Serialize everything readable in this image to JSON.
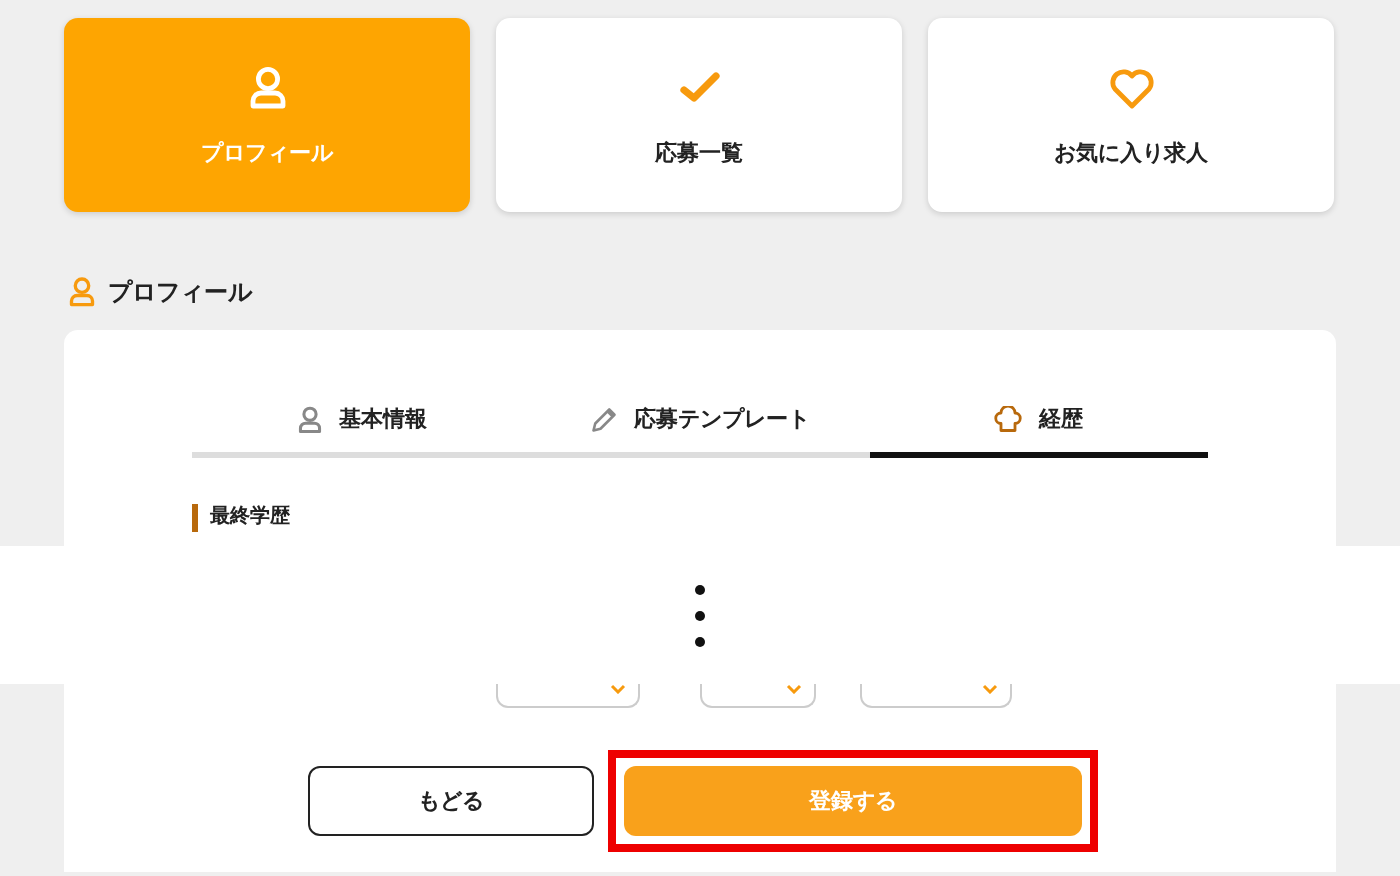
{
  "nav_cards": [
    {
      "label": "プロフィール",
      "kind": "person",
      "selected": true
    },
    {
      "label": "応募一覧",
      "kind": "check",
      "selected": false
    },
    {
      "label": "お気に入り求人",
      "kind": "heart",
      "selected": false
    }
  ],
  "section_title": "プロフィール",
  "tabs": [
    {
      "label": "基本情報",
      "kind": "person",
      "selected": false
    },
    {
      "label": "応募テンプレート",
      "kind": "pencil",
      "selected": false
    },
    {
      "label": "経歴",
      "kind": "chef-hat",
      "selected": true
    }
  ],
  "subsection_title": "最終学歴",
  "form_row": {
    "kind": "dropdowns"
  },
  "buttons": [
    {
      "label": "もどる",
      "kind": "secondary",
      "highlighted": false
    },
    {
      "label": "登録する",
      "kind": "primary",
      "highlighted": true
    }
  ]
}
